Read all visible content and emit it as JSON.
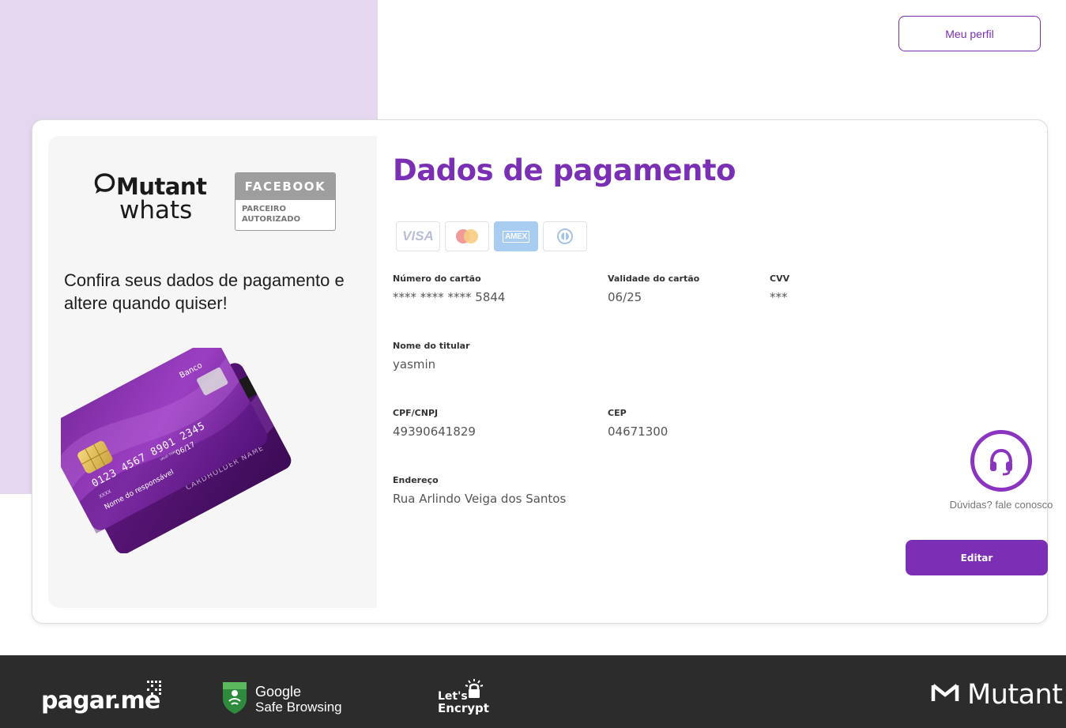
{
  "header": {
    "profile_button": "Meu perfil"
  },
  "brand": {
    "name_top": "Mutant",
    "name_bottom": "whats",
    "partner_badge_top": "FACEBOOK",
    "partner_badge_bottom_1": "PARCEIRO",
    "partner_badge_bottom_2": "AUTORIZADO"
  },
  "left_panel": {
    "headline": "Confira seus dados de pagamento e altere quando quiser!",
    "card_front": {
      "bank": "Banco",
      "number": "0123 4567 8901 2345",
      "valid_label": "VALID THRU",
      "expiry": "06/17",
      "small_code": "XXXX",
      "holder": "Nome do responsável"
    },
    "card_back": {
      "holder": "CARDHOLDER NAME"
    }
  },
  "main": {
    "title": "Dados de pagamento",
    "card_brands": [
      "VISA",
      "Mastercard",
      "AMEX",
      "Diners"
    ],
    "amex_label": "AMEX",
    "fields": {
      "card_number": {
        "label": "Número do cartão",
        "value": "**** **** **** 5844"
      },
      "card_expiry": {
        "label": "Validade do cartão",
        "value": "06/25"
      },
      "cvv": {
        "label": "CVV",
        "value": "***"
      },
      "holder_name": {
        "label": "Nome do titular",
        "value": "yasmin"
      },
      "document": {
        "label": "CPF/CNPJ",
        "value": "49390641829"
      },
      "cep": {
        "label": "CEP",
        "value": "04671300"
      },
      "address": {
        "label": "Endereço",
        "value": "Rua Arlindo Veiga dos Santos"
      }
    },
    "help_text": "Dúvidas? fale conosco",
    "edit_button": "Editar"
  },
  "footer": {
    "pagarme": "pagar.me",
    "google_line1": "Google",
    "google_line2": "Safe Browsing",
    "letsencrypt_line1": "Let's",
    "letsencrypt_line2": "Encrypt",
    "mutant": "Mutant"
  },
  "colors": {
    "accent": "#7b2fb5",
    "lilac_bg": "#e4d7ef",
    "footer_bg": "#2c2c2c"
  }
}
